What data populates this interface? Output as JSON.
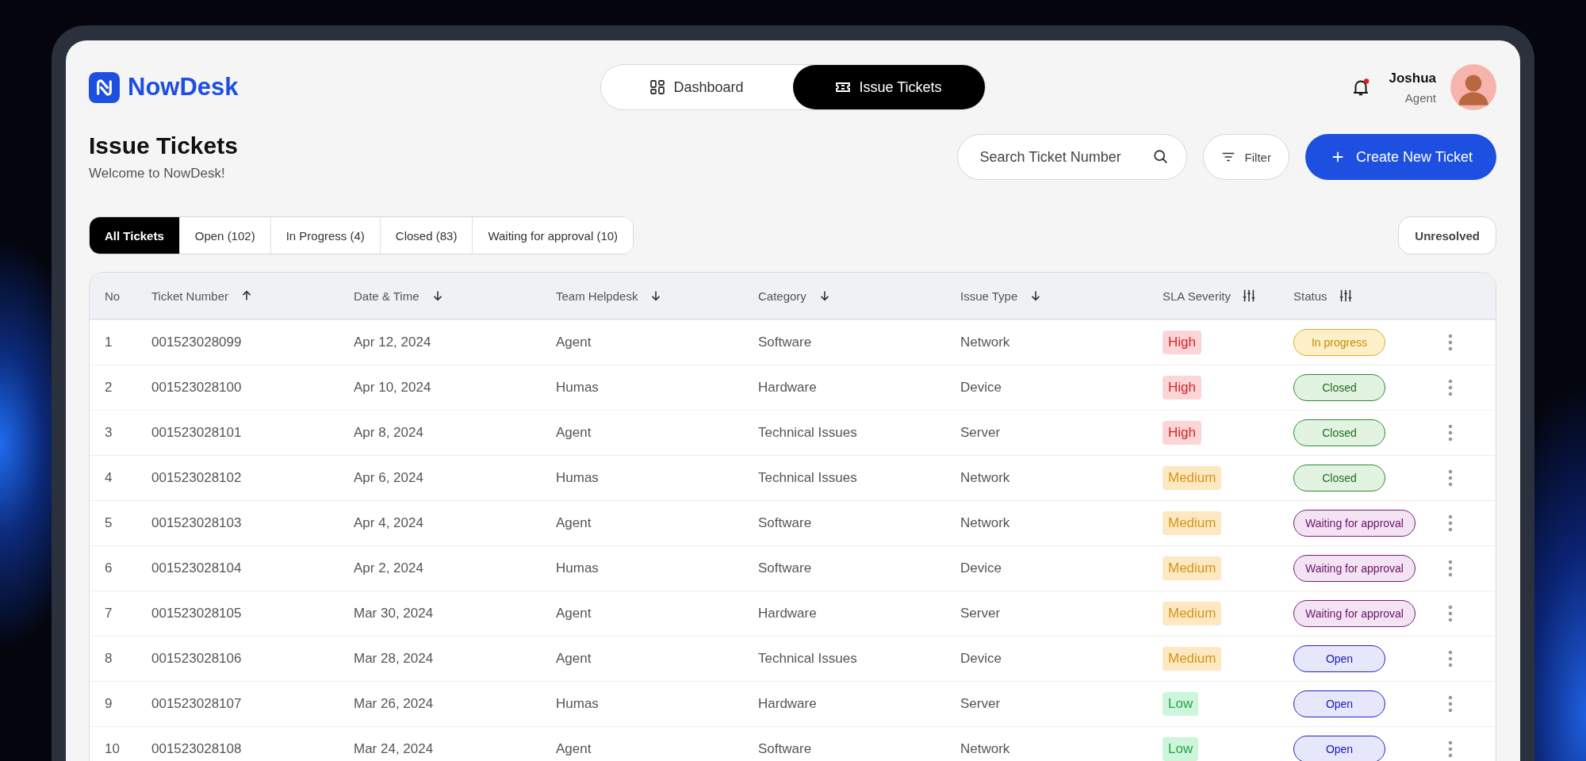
{
  "brand": {
    "name": "NowDesk"
  },
  "nav": [
    {
      "label": "Dashboard",
      "kind": "grid",
      "selected": false
    },
    {
      "label": "Issue Tickets",
      "kind": "ticket",
      "selected": true
    }
  ],
  "user": {
    "name": "Joshua",
    "role": "Agent",
    "unread": true
  },
  "page": {
    "title": "Issue Tickets",
    "subtitle": "Welcome to NowDesk!"
  },
  "search": {
    "placeholder": "Search Ticket Number"
  },
  "filter_button": "Filter",
  "create_button": "Create New Ticket",
  "tabs": [
    {
      "label": "All Tickets",
      "selected": true
    },
    {
      "label": "Open (102)",
      "selected": false
    },
    {
      "label": "In Progress (4)",
      "selected": false
    },
    {
      "label": "Closed (83)",
      "selected": false
    },
    {
      "label": "Waiting for approval (10)",
      "selected": false
    }
  ],
  "unresolved_button": "Unresolved",
  "table": {
    "columns": [
      {
        "label": "No",
        "kind": "none"
      },
      {
        "label": "Ticket Number",
        "kind": "asc"
      },
      {
        "label": "Date & Time",
        "kind": "desc"
      },
      {
        "label": "Team Helpdesk",
        "kind": "desc"
      },
      {
        "label": "Category",
        "kind": "desc"
      },
      {
        "label": "Issue Type",
        "kind": "desc"
      },
      {
        "label": "SLA Severity",
        "kind": "adjust"
      },
      {
        "label": "Status",
        "kind": "adjust"
      }
    ],
    "rows": [
      {
        "no": "1",
        "ticket": "001523028099",
        "date": "Apr 12, 2024",
        "team": "Agent",
        "category": "Software",
        "issue_type": "Network",
        "severity": {
          "text": "High",
          "kind": "high"
        },
        "status": {
          "text": "In progress",
          "kind": "progress"
        }
      },
      {
        "no": "2",
        "ticket": "001523028100",
        "date": "Apr 10, 2024",
        "team": "Humas",
        "category": "Hardware",
        "issue_type": "Device",
        "severity": {
          "text": "High",
          "kind": "high"
        },
        "status": {
          "text": "Closed",
          "kind": "closed"
        }
      },
      {
        "no": "3",
        "ticket": "001523028101",
        "date": "Apr 8, 2024",
        "team": "Agent",
        "category": "Technical Issues",
        "issue_type": "Server",
        "severity": {
          "text": "High",
          "kind": "high"
        },
        "status": {
          "text": "Closed",
          "kind": "closed"
        }
      },
      {
        "no": "4",
        "ticket": "001523028102",
        "date": "Apr 6, 2024",
        "team": "Humas",
        "category": "Technical Issues",
        "issue_type": "Network",
        "severity": {
          "text": "Medium",
          "kind": "medium"
        },
        "status": {
          "text": "Closed",
          "kind": "closed"
        }
      },
      {
        "no": "5",
        "ticket": "001523028103",
        "date": "Apr 4, 2024",
        "team": "Agent",
        "category": "Software",
        "issue_type": "Network",
        "severity": {
          "text": "Medium",
          "kind": "medium"
        },
        "status": {
          "text": "Waiting for approval",
          "kind": "waiting"
        }
      },
      {
        "no": "6",
        "ticket": "001523028104",
        "date": "Apr 2, 2024",
        "team": "Humas",
        "category": "Software",
        "issue_type": "Device",
        "severity": {
          "text": "Medium",
          "kind": "medium"
        },
        "status": {
          "text": "Waiting for approval",
          "kind": "waiting"
        }
      },
      {
        "no": "7",
        "ticket": "001523028105",
        "date": "Mar 30, 2024",
        "team": "Agent",
        "category": "Hardware",
        "issue_type": "Server",
        "severity": {
          "text": "Medium",
          "kind": "medium"
        },
        "status": {
          "text": "Waiting for approval",
          "kind": "waiting"
        }
      },
      {
        "no": "8",
        "ticket": "001523028106",
        "date": "Mar 28, 2024",
        "team": "Agent",
        "category": "Technical Issues",
        "issue_type": "Device",
        "severity": {
          "text": "Medium",
          "kind": "medium"
        },
        "status": {
          "text": "Open",
          "kind": "open"
        }
      },
      {
        "no": "9",
        "ticket": "001523028107",
        "date": "Mar 26, 2024",
        "team": "Humas",
        "category": "Hardware",
        "issue_type": "Server",
        "severity": {
          "text": "Low",
          "kind": "low"
        },
        "status": {
          "text": "Open",
          "kind": "open"
        }
      },
      {
        "no": "10",
        "ticket": "001523028108",
        "date": "Mar 24, 2024",
        "team": "Agent",
        "category": "Software",
        "issue_type": "Network",
        "severity": {
          "text": "Low",
          "kind": "low"
        },
        "status": {
          "text": "Open",
          "kind": "open"
        }
      }
    ]
  }
}
